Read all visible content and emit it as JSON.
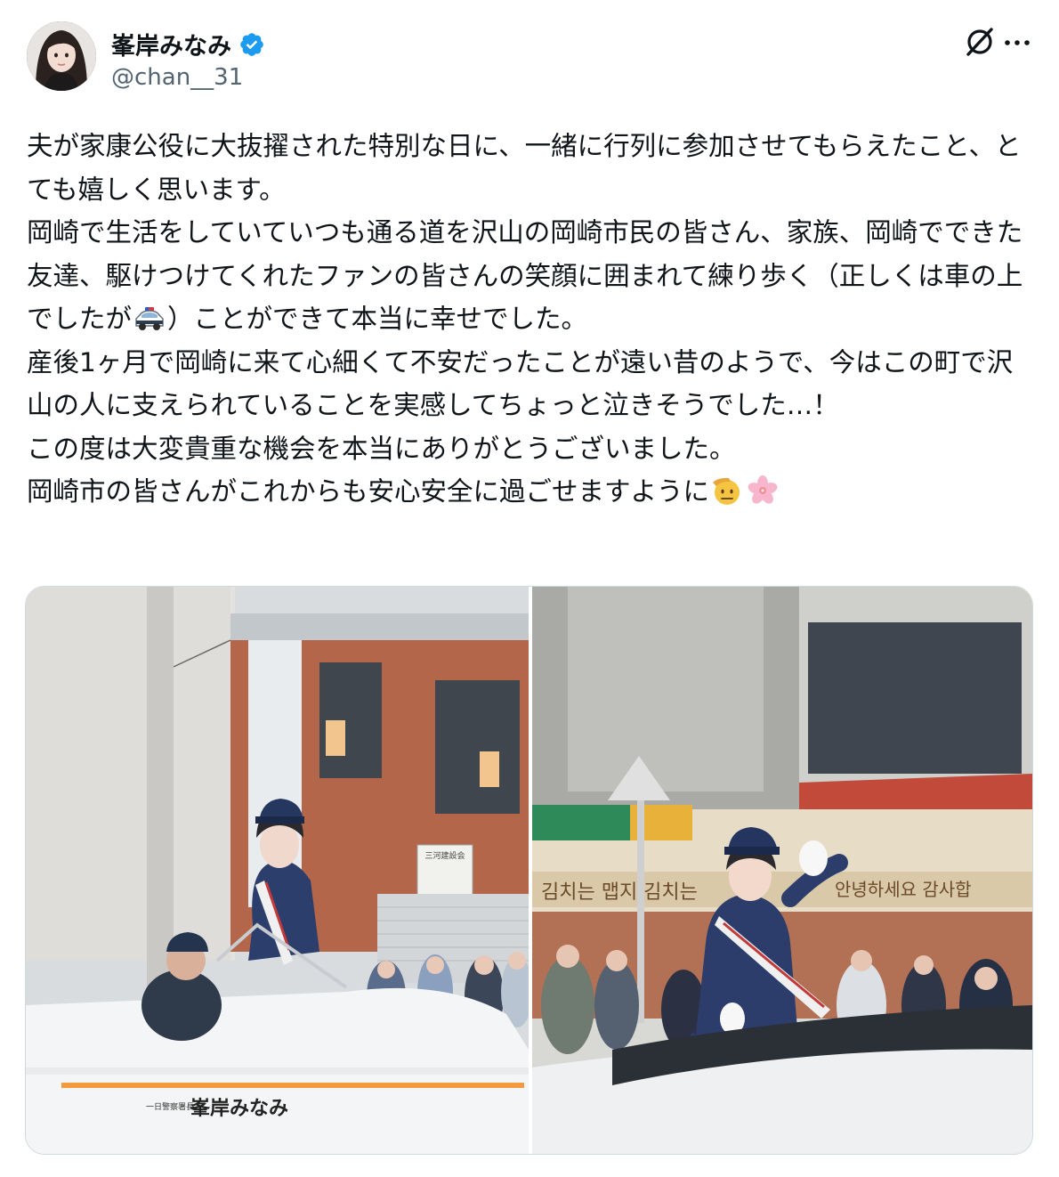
{
  "author": {
    "display_name": "峯岸みなみ",
    "handle": "@chan__31",
    "verified": true
  },
  "icons": {
    "verified": "verified-badge-icon",
    "grok": "grok-icon",
    "more": "more-options-icon",
    "police_car_emoji": "police-car-emoji",
    "salute_emoji": "saluting-face-emoji",
    "blossom_emoji": "cherry-blossom-emoji"
  },
  "colors": {
    "verified_blue": "#1d9bf0",
    "text": "#0f1419",
    "muted": "#536471"
  },
  "tweet": {
    "p1": "夫が家康公役に大抜擢された特別な日に、一緒に行列に参加させてもらえたこと、とても嬉しく思います。",
    "p2_a": "岡崎で生活をしていていつも通る道を沢山の岡崎市民の皆さん、家族、岡崎でできた友達、駆けつけてくれたファンの皆さんの笑顔に囲まれて練り歩く（正しくは車の上でしたが",
    "p2_b": "）ことができて本当に幸せでした。",
    "p3": "産後1ヶ月で岡崎に来て心細くて不安だったことが遠い昔のようで、今はこの町で沢山の人に支えられていることを実感してちょっと泣きそうでした…！",
    "p4": "この度は大変貴重な機会を本当にありがとうございました。",
    "p5": "岡崎市の皆さんがこれからも安心安全に過ごせますように"
  },
  "media": {
    "photo_left": {
      "car_door_small": "一日警察署長",
      "car_door_name": "峯岸みなみ",
      "sign_text": "三河建設会"
    },
    "photo_right": {
      "sign_left": "김치는 맵지 김치는",
      "sign_right": "안녕하세요 감사합"
    }
  }
}
